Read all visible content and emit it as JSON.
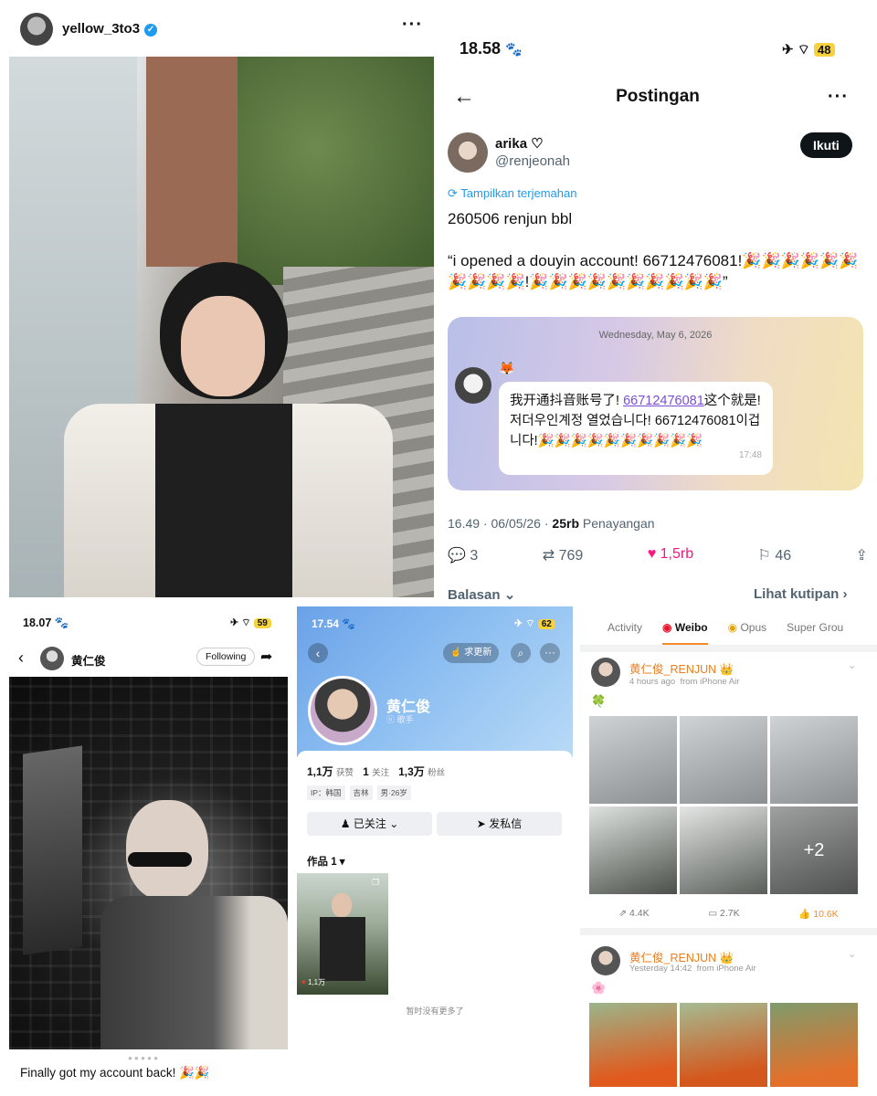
{
  "instagram": {
    "username": "yellow_3to3",
    "caption": "Finally got my account back! 🎉🎉"
  },
  "x_post": {
    "time": "18.58",
    "battery": "48",
    "title": "Postingan",
    "display_name": "arika ♡",
    "handle": "@renjeonah",
    "follow_label": "Ikuti",
    "translate_label": "Tampilkan terjemahan",
    "text_line1": "260506 renjun bbl",
    "text_line2": "“i opened a douyin account! 66712476081!🎉🎉🎉🎉🎉🎉🎉🎉🎉🎉!🎉🎉🎉🎉🎉🎉🎉🎉🎉🎉”",
    "chat_date": "Wednesday, May 6, 2026",
    "chat_msg_pre": "我开通抖音账号了! ",
    "chat_msg_link": "66712476081",
    "chat_msg_post": "这个就是!",
    "chat_msg_kr": "저더우인계정 열었습니다! 66712476081이겁니다!🎉🎉🎉🎉🎉🎉🎉🎉🎉🎉",
    "chat_time": "17:48",
    "meta_time": "16.49 · 06/05/26 · ",
    "views_count": "25rb",
    "views_label": " Penayangan",
    "replies": "3",
    "reposts": "769",
    "likes": "1,5rb",
    "bookmarks": "46",
    "footer_left": "Balasan ⌄",
    "footer_right": "Lihat kutipan ›"
  },
  "bottom_left": {
    "time": "18.07",
    "battery": "59",
    "name": "黄仁俊",
    "follow_state": "Following",
    "caption": "Finally got my account back! 🎉🎉"
  },
  "douyin": {
    "time": "17.54",
    "battery": "62",
    "update_btn": "求更新",
    "name": "黄仁俊",
    "role": "歌手",
    "likes_num": "1,1万",
    "likes_label": "获赞",
    "following_num": "1",
    "following_label": "关注",
    "fans_num": "1,3万",
    "fans_label": "粉丝",
    "tags": [
      "IP：韩国",
      "吉林",
      "男·26岁"
    ],
    "followed_btn": "已关注",
    "message_btn": "发私信",
    "works_label": "作品 1 ▾",
    "video_likes": "1,1万",
    "no_more": "暂时没有更多了"
  },
  "weibo": {
    "tabs": [
      "Activity",
      "Weibo",
      "Opus",
      "Super Grou"
    ],
    "post1": {
      "name": "黄仁俊_RENJUN",
      "time": "4 hours ago",
      "source": "from iPhone Air",
      "text": "🍀",
      "more": "+2",
      "reposts": "4.4K",
      "comments": "2.7K",
      "likes": "10.6K"
    },
    "post2": {
      "name": "黄仁俊_RENJUN",
      "time": "Yesterday 14:42",
      "source": "from iPhone Air",
      "text": "🌸"
    }
  }
}
